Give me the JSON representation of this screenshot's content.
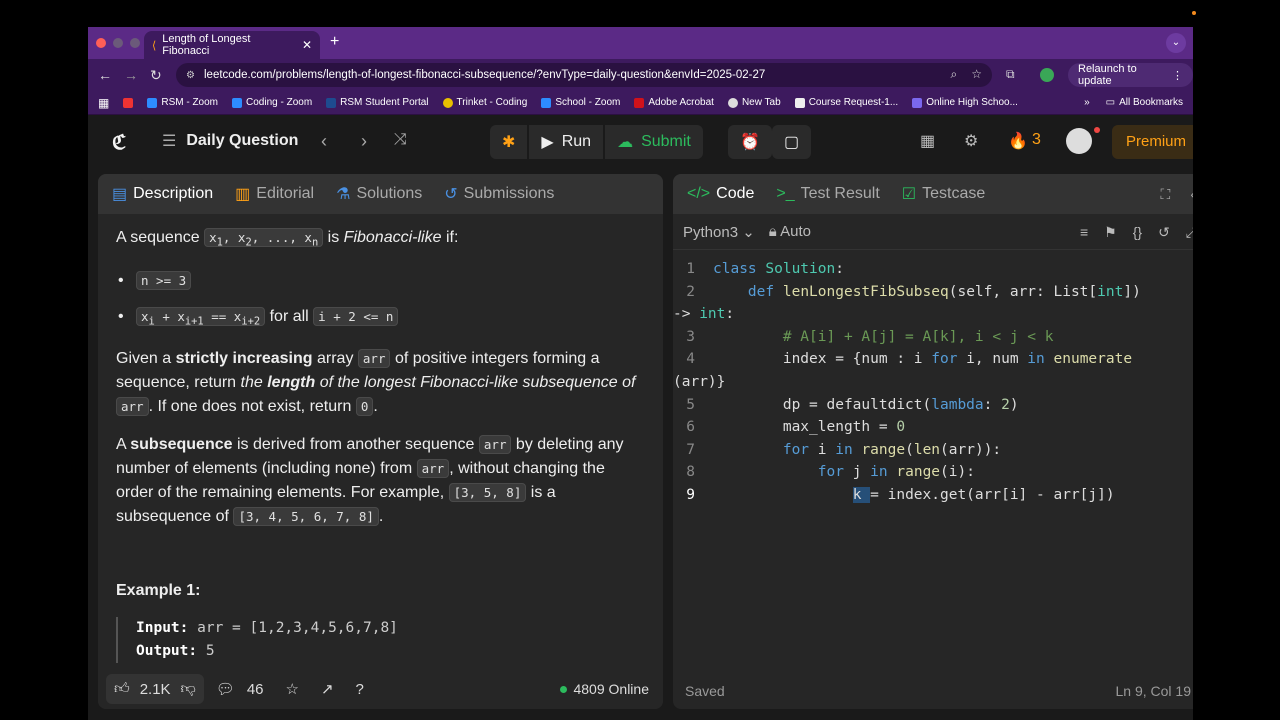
{
  "browser": {
    "tab_title": "Length of Longest Fibonacci",
    "url": "leetcode.com/problems/length-of-longest-fibonacci-subsequence/?envType=daily-question&envId=2025-02-27",
    "relaunch_label": "Relaunch to update",
    "bookmarks": [
      "RSM - Zoom",
      "Coding - Zoom",
      "RSM Student Portal",
      "Trinket - Coding",
      "School - Zoom",
      "Adobe Acrobat",
      "New Tab",
      "Course Request-1...",
      "Online High Schoo..."
    ],
    "all_bookmarks": "All Bookmarks"
  },
  "header": {
    "daily_question": "Daily Question",
    "run": "Run",
    "submit": "Submit",
    "streak": "3",
    "premium": "Premium"
  },
  "left_tabs": [
    "Description",
    "Editorial",
    "Solutions",
    "Submissions"
  ],
  "description": {
    "p1_a": "A sequence",
    "p1_code": "x1, x2, ..., xn",
    "p1_b": "is",
    "p1_em": "Fibonacci-like",
    "p1_c": "if:",
    "b1": "n >= 3",
    "b2_code": "xi + xi+1 == xi+2",
    "b2_text": "for all",
    "b2_code2": "i + 2 <= n",
    "p2_a": "Given a",
    "p2_b": "strictly increasing",
    "p2_c": "array",
    "p2_code": "arr",
    "p2_d": "of positive integers forming a sequence, return",
    "p2_e": "the",
    "p2_f": "length",
    "p2_g": "of the longest Fibonacci-like subsequence of",
    "p2_code2": "arr",
    "p2_h": ". If one does not exist, return",
    "p2_code3": "0",
    "p3_a": "A",
    "p3_b": "subsequence",
    "p3_c": "is derived from another sequence",
    "p3_code": "arr",
    "p3_d": "by deleting any number of elements (including none) from",
    "p3_code2": "arr",
    "p3_e": ", without changing the order of the remaining elements. For example,",
    "p3_code3": "[3, 5, 8]",
    "p3_f": "is a subsequence of",
    "p3_code4": "[3, 4, 5, 6, 7, 8]",
    "example_title": "Example 1:",
    "input_label": "Input:",
    "input_value": "arr = [1,2,3,4,5,6,7,8]",
    "output_label": "Output:",
    "output_value": "5"
  },
  "left_footer": {
    "likes": "2.1K",
    "comments": "46",
    "online": "4809 Online"
  },
  "right_tabs": [
    "Code",
    "Test Result",
    "Testcase"
  ],
  "editor": {
    "language": "Python3",
    "mode": "Auto",
    "status": "Saved",
    "position": "Ln 9, Col 19"
  },
  "code_lines": [
    "1",
    "2",
    "",
    "3",
    "4",
    "",
    "5",
    "6",
    "7",
    "8",
    "9"
  ]
}
